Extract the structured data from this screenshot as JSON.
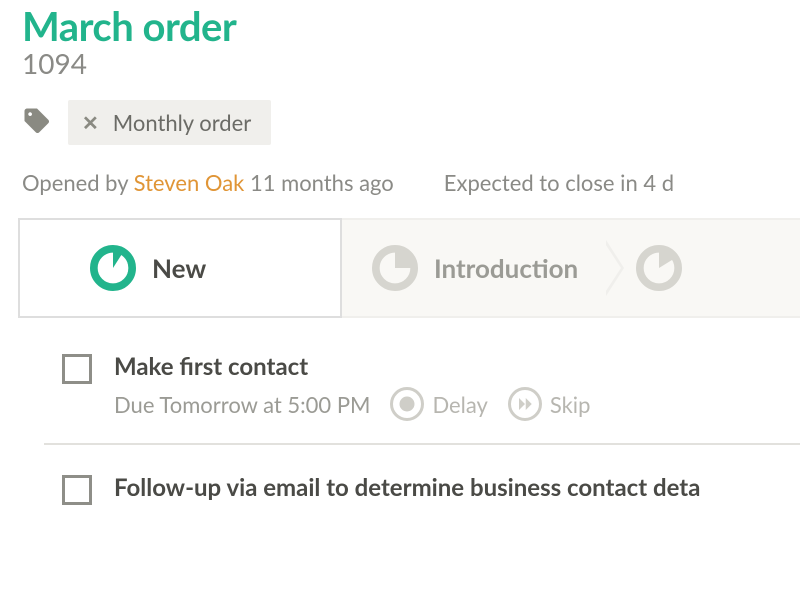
{
  "header": {
    "title": "March order",
    "number": "1094"
  },
  "tag": {
    "label": "Monthly order"
  },
  "meta": {
    "opened_prefix": "Opened by ",
    "opened_author": "Steven Oak",
    "opened_suffix": " 11 months ago",
    "expected": "Expected to close in 4 d"
  },
  "stages": {
    "active": {
      "label": "New"
    },
    "next": {
      "label": "Introduction"
    }
  },
  "tasks": [
    {
      "title": "Make first contact",
      "due": "Due Tomorrow at 5:00 PM",
      "delay_label": "Delay",
      "skip_label": "Skip"
    },
    {
      "title": "Follow-up via email to determine business contact deta"
    }
  ]
}
